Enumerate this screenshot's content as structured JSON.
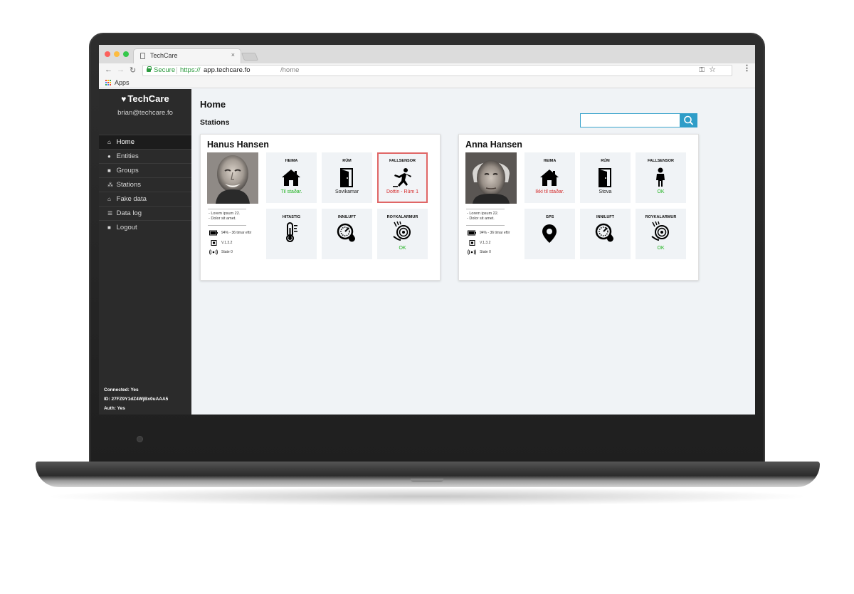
{
  "browser": {
    "tab_title": "TechCare",
    "tab_close": "×",
    "secure_label": "Secure",
    "url_protocol": "https://",
    "url_host": "app.techcare.fo",
    "url_path": "/home",
    "bookmark_apps": "Apps",
    "back": "←",
    "forward": "→",
    "reload": "↻",
    "key": "⚿",
    "star": "☆",
    "menu": "⋮"
  },
  "sidebar": {
    "brand": "TechCare",
    "email": "brian@techcare.fo",
    "items": [
      {
        "label": "Home",
        "icon": "⌂"
      },
      {
        "label": "Entities",
        "icon": "●"
      },
      {
        "label": "Groups",
        "icon": "■"
      },
      {
        "label": "Stations",
        "icon": "⁂"
      },
      {
        "label": "Fake data",
        "icon": "⌂"
      },
      {
        "label": "Data log",
        "icon": "☰"
      },
      {
        "label": "Logout",
        "icon": "■"
      }
    ],
    "status": {
      "connected": "Connected: Yes",
      "id": "ID: 27FZ9Y1dZ4WjBx0uAAA5",
      "auth": "Auth: Yes"
    }
  },
  "main": {
    "title": "Home",
    "section": "Stations",
    "search": {
      "value": "",
      "placeholder": ""
    }
  },
  "stations": [
    {
      "name": "Hanus Hansen",
      "info": [
        "- Lorem ipsum 22.",
        "- Dolor sit amet."
      ],
      "battery": "94% - 36 timar eftir",
      "version": "V.1.3.2",
      "state": "State 0",
      "tiles": [
        {
          "label": "HEIMA",
          "icon": "house-icon",
          "status": "Til staðar.",
          "status_color": "green"
        },
        {
          "label": "RÚM",
          "icon": "door-icon",
          "status": "Sovikamar",
          "status_color": "dark"
        },
        {
          "label": "FALLSENSOR",
          "icon": "falling-person-icon",
          "status": "Dottin - Rúm 1",
          "status_color": "red",
          "alert": true
        },
        {
          "label": "HITASTIG",
          "icon": "thermometer-icon",
          "status": "",
          "status_color": "dark"
        },
        {
          "label": "INNILUFT",
          "icon": "humidity-gauge-icon",
          "status": "",
          "status_color": "dark"
        },
        {
          "label": "ROYKALARMUR",
          "icon": "smoke-alarm-icon",
          "status": "OK",
          "status_color": "green"
        }
      ]
    },
    {
      "name": "Anna Hansen",
      "info": [
        "- Lorem ipsum 22.",
        "- Dolor sit amet."
      ],
      "battery": "94% - 36 timar eftir",
      "version": "V.1.3.2",
      "state": "State 0",
      "tiles": [
        {
          "label": "HEIMA",
          "icon": "house-icon",
          "status": "Ikki til staðar.",
          "status_color": "red"
        },
        {
          "label": "RÚM",
          "icon": "door-icon",
          "status": "Stova",
          "status_color": "dark"
        },
        {
          "label": "FALLSENSOR",
          "icon": "standing-person-icon",
          "status": "OK",
          "status_color": "green"
        },
        {
          "label": "GPS",
          "icon": "map-pin-icon",
          "status": "",
          "status_color": "dark"
        },
        {
          "label": "INNILUFT",
          "icon": "humidity-gauge-icon",
          "status": "",
          "status_color": "dark"
        },
        {
          "label": "ROYKALARMUR",
          "icon": "smoke-alarm-icon",
          "status": "OK",
          "status_color": "green"
        }
      ]
    }
  ],
  "colors": {
    "sidebar_bg": "#2b2b2b",
    "main_bg": "#f0f3f6",
    "accent": "#2f9dc8",
    "ok_green": "#21b321",
    "alert_red": "#d52b2b"
  }
}
